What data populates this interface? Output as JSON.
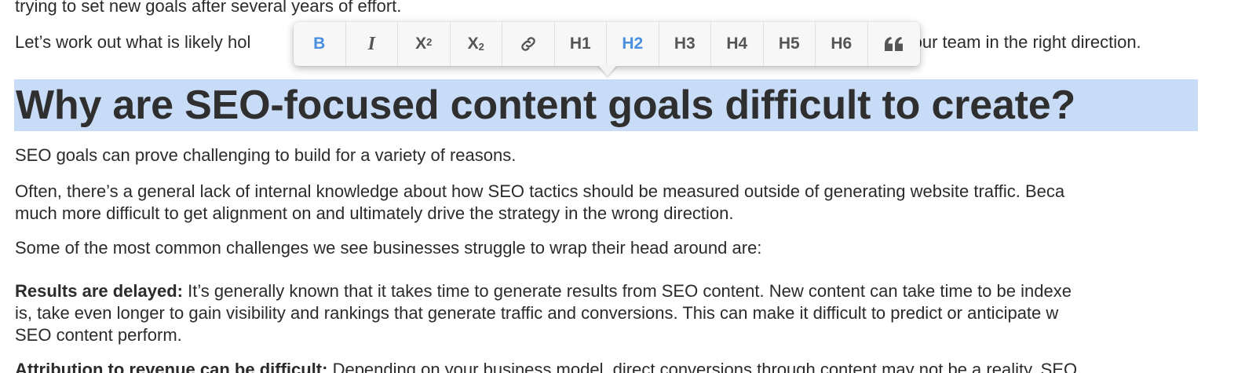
{
  "document": {
    "line_top_cut": "trying to set new goals after several years of effort.",
    "line_intro_left": "Let’s work out what is likely hol",
    "line_intro_right": "t your team in the right direction.",
    "heading": "Why are SEO-focused content goals difficult to create?",
    "p1": "SEO goals can prove challenging to build for a variety of reasons.",
    "p2_line1": "Often, there’s a general lack of internal knowledge about how SEO tactics should be measured outside of generating website traffic. Beca",
    "p2_line2": "much more difficult to get alignment on and ultimately drive the strategy in the wrong direction.",
    "p3": "Some of the most common challenges we see businesses struggle to wrap their head around are:",
    "item1_bold": "Results are delayed:",
    "item1_line1": " It’s generally known that it takes time to generate results from SEO content. New content can take time to be indexe",
    "item1_line2": "is, take even longer to gain visibility and rankings that generate traffic and conversions. This can make it difficult to predict or anticipate w",
    "item1_line3": "SEO content perform.",
    "item2_bold": "Attribution to revenue can be difficult:",
    "item2_text": " Depending on your business model, direct conversions through content may not be a reality. SEO"
  },
  "toolbar": {
    "bold": "B",
    "italic": "I",
    "superscript_base": "X",
    "superscript_mark": "2",
    "subscript_base": "X",
    "subscript_mark": "2",
    "link_icon": "link-icon",
    "h1": "H1",
    "h2": "H2",
    "h3": "H3",
    "h4": "H4",
    "h5": "H5",
    "h6": "H6",
    "quote_icon": "quote-icon",
    "active_item": "H2",
    "active_color": "#4a8fe0",
    "selection_color": "#c9dcf7"
  }
}
